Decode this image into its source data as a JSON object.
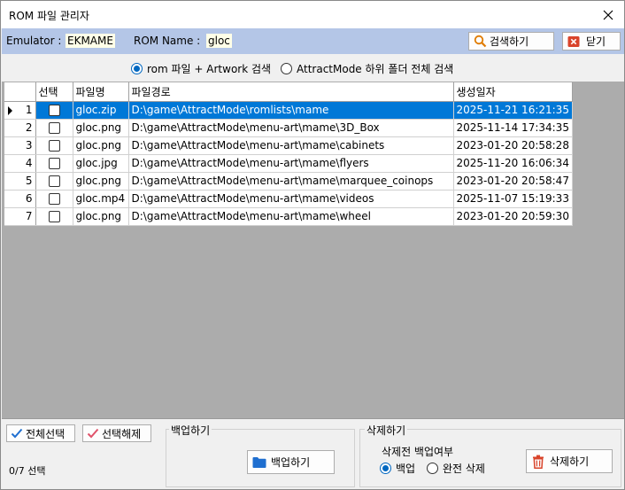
{
  "window": {
    "title": "ROM 파일 관리자"
  },
  "infobar": {
    "emulator_label": "Emulator :",
    "emulator_value": "EKMAME",
    "romname_label": "ROM Name :",
    "romname_value": "gloc",
    "search_button": "검색하기",
    "close_button": "닫기"
  },
  "search_options": [
    {
      "label": "rom 파일 + Artwork 검색",
      "selected": true
    },
    {
      "label": "AttractMode 하위 폴더 전체 검색",
      "selected": false
    }
  ],
  "grid": {
    "columns": [
      "선택",
      "파일명",
      "파일경로",
      "생성일자"
    ],
    "rows": [
      {
        "no": "1",
        "name": "gloc.zip",
        "path": "D:\\game\\AttractMode\\romlists\\mame",
        "date": "2025-11-21 16:21:35",
        "selected": true
      },
      {
        "no": "2",
        "name": "gloc.png",
        "path": "D:\\game\\AttractMode\\menu-art\\mame\\3D_Box",
        "date": "2025-11-14 17:34:35",
        "selected": false
      },
      {
        "no": "3",
        "name": "gloc.png",
        "path": "D:\\game\\AttractMode\\menu-art\\mame\\cabinets",
        "date": "2023-01-20 20:58:28",
        "selected": false
      },
      {
        "no": "4",
        "name": "gloc.jpg",
        "path": "D:\\game\\AttractMode\\menu-art\\mame\\flyers",
        "date": "2025-11-20 16:06:34",
        "selected": false
      },
      {
        "no": "5",
        "name": "gloc.png",
        "path": "D:\\game\\AttractMode\\menu-art\\mame\\marquee_coinops",
        "date": "2023-01-20 20:58:47",
        "selected": false
      },
      {
        "no": "6",
        "name": "gloc.mp4",
        "path": "D:\\game\\AttractMode\\menu-art\\mame\\videos",
        "date": "2025-11-07 15:19:33",
        "selected": false
      },
      {
        "no": "7",
        "name": "gloc.png",
        "path": "D:\\game\\AttractMode\\menu-art\\mame\\wheel",
        "date": "2023-01-20 20:59:30",
        "selected": false
      }
    ]
  },
  "bottom": {
    "select_all": "전체선택",
    "deselect_all": "선택해제",
    "count": "0/7 선택",
    "backup_group": "백업하기",
    "backup_button": "백업하기",
    "delete_group": "삭제하기",
    "backup_before_delete_label": "삭제전 백업여부",
    "delete_options": [
      {
        "label": "백업",
        "selected": true
      },
      {
        "label": "완전 삭제",
        "selected": false
      }
    ],
    "delete_button": "삭제하기"
  },
  "colors": {
    "infobar_bg": "#b4c6e7",
    "selection": "#0078d7",
    "accent": "#0067c0",
    "delete_icon": "#d9442b",
    "folder_icon": "#1f6fd0"
  },
  "icons": {
    "search": "search-icon",
    "close_window": "close-icon",
    "close_button": "close-x-icon",
    "check_all": "check-icon",
    "uncheck_all": "check-icon",
    "backup": "folder-icon",
    "delete": "trash-icon"
  }
}
